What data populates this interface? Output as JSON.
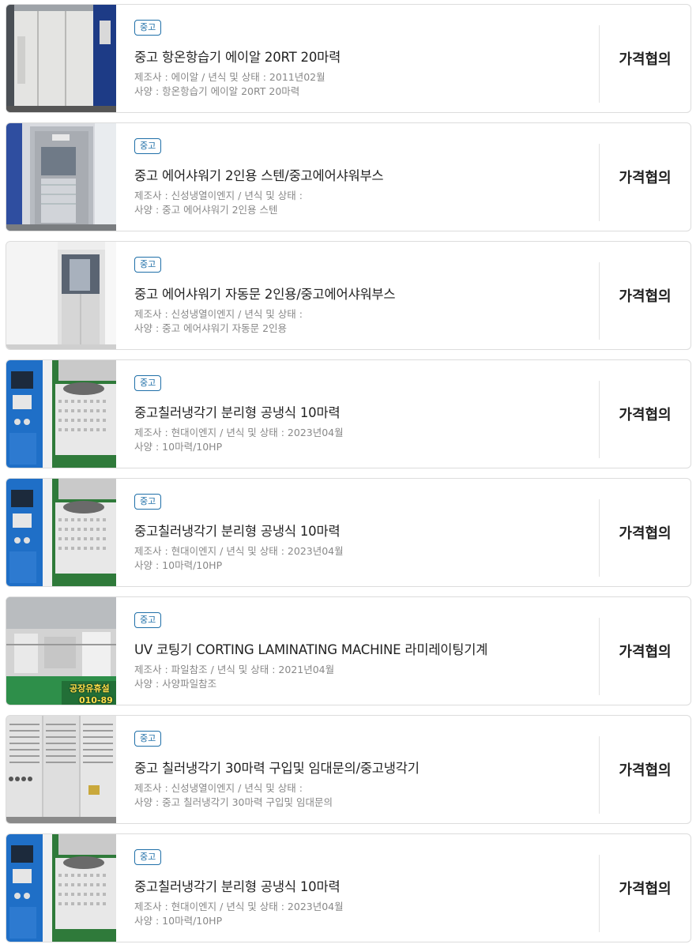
{
  "listings": [
    {
      "badge": "중고",
      "title": "중고 항온항습기 에이알 20RT 20마력",
      "meta": "제조사 : 에이알 / 년식 및 상태 : 2011년02월",
      "spec": "사양 : 항온항습기 에이알 20RT 20마력",
      "price": "가격협의",
      "image": "grey-cabinet-photo"
    },
    {
      "badge": "중고",
      "title": "중고 에어샤워기 2인용 스텐/중고에어샤워부스",
      "meta": "제조사 : 신성냉열이엔지 / 년식 및 상태 :",
      "spec": "사양 : 중고 에어샤워기 2인용 스텐",
      "price": "가격협의",
      "image": "air-shower-steel-photo"
    },
    {
      "badge": "중고",
      "title": "중고 에어샤워기 자동문 2인용/중고에어샤워부스",
      "meta": "제조사 : 신성냉열이엔지 / 년식 및 상태 :",
      "spec": "사양 : 중고 에어샤워기 자동문 2인용",
      "price": "가격협의",
      "image": "air-shower-white-photo"
    },
    {
      "badge": "중고",
      "title": "중고칠러냉각기 분리형 공냉식 10마력",
      "meta": "제조사 : 현대이엔지 / 년식 및 상태 : 2023년04월",
      "spec": "사양 : 10마력/10HP",
      "price": "가격협의",
      "image": "chiller-blue-photo"
    },
    {
      "badge": "중고",
      "title": "중고칠러냉각기 분리형 공냉식 10마력",
      "meta": "제조사 : 현대이엔지 / 년식 및 상태 : 2023년04월",
      "spec": "사양 : 10마력/10HP",
      "price": "가격협의",
      "image": "chiller-blue-photo"
    },
    {
      "badge": "중고",
      "title": "UV 코팅기 CORTING LAMINATING MACHINE 라미레이팅기계",
      "meta": "제조사 : 파일참조 / 년식 및 상태 : 2021년04월",
      "spec": "사양 : 사양파일참조",
      "price": "가격협의",
      "image": "laminating-machine-photo",
      "overlay_line1": "공장유휴설",
      "overlay_line2": "010-89"
    },
    {
      "badge": "중고",
      "title": "중고 칠러냉각기 30마력 구입및 임대문의/중고냉각기",
      "meta": "제조사 : 신성냉열이엔지 / 년식 및 상태 :",
      "spec": "사양 : 중고 칠러냉각기 30마력 구입및 임대문의",
      "price": "가격협의",
      "image": "chiller-grey-photo"
    },
    {
      "badge": "중고",
      "title": "중고칠러냉각기 분리형 공냉식 10마력",
      "meta": "제조사 : 현대이엔지 / 년식 및 상태 : 2023년04월",
      "spec": "사양 : 10마력/10HP",
      "price": "가격협의",
      "image": "chiller-blue-photo"
    }
  ],
  "colors": {
    "badge": "#1f6fa8",
    "title": "#222222",
    "meta": "#888888",
    "border": "#dcdcdc"
  }
}
